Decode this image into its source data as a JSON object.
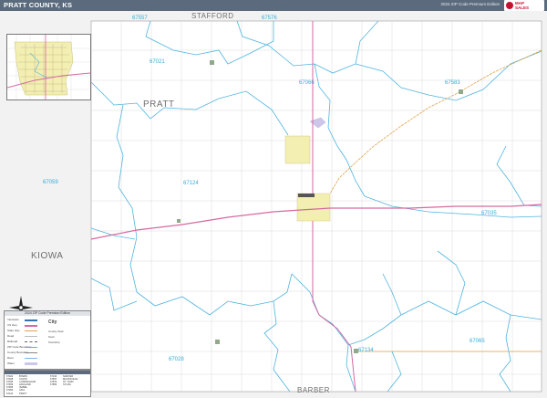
{
  "header": {
    "title": "PRATT COUNTY, KS",
    "edition": "2024 ZIP Code Premium Edition"
  },
  "neighbors": {
    "north": "STAFFORD",
    "south": "BARBER",
    "west": "KIOWA",
    "county": "PRATT"
  },
  "zip_codes": [
    "67557",
    "67576",
    "67021",
    "67066",
    "67583",
    "67059",
    "67124",
    "67035",
    "67134",
    "67065",
    "67028"
  ],
  "legend": {
    "title": "2024 ZIP Code Premium Edition",
    "rows": [
      "Interstate",
      "US Hwy",
      "State Hwy",
      "Road",
      "Railroad",
      "ZIP Code Boundary",
      "County Boundary",
      "River",
      "Water"
    ],
    "right": [
      "City",
      "County Seat",
      "Town",
      "Township"
    ]
  },
  "city_table": {
    "col1": [
      "67021",
      "67028",
      "67035",
      "67059",
      "67065",
      "67066",
      "67124"
    ],
    "col2": [
      "BYERS",
      "COATS",
      "CUNNINGHAM",
      "HAVILAND",
      "ISABEL",
      "IUKA",
      "PRATT"
    ],
    "col3": [
      "67134",
      "67557",
      "67576",
      "67583",
      "",
      "",
      ""
    ],
    "col4": [
      "SAWYER",
      "MACKSVILLE",
      "ST. JOHN",
      "SYLVIA",
      "",
      "",
      ""
    ]
  },
  "colors": {
    "zip_boundary": "#4fb4df",
    "us_highway": "#d46aa0",
    "state_highway": "#e0a24a",
    "road": "#c9c9c9",
    "city_fill": "#f3eeb2",
    "background": "#f2f2f2",
    "title_bar": "#5b6b7d"
  },
  "icons": [
    "compass-rose-icon",
    "logo-icon"
  ]
}
